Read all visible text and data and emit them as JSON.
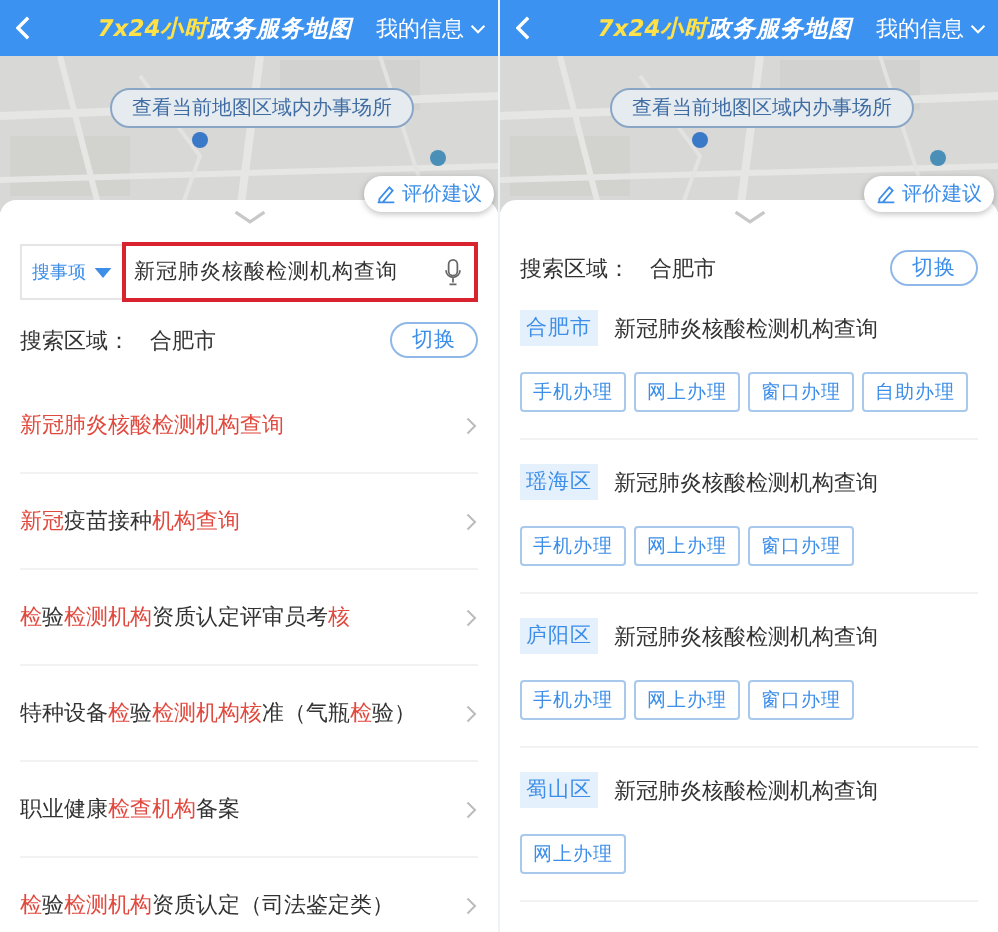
{
  "left": {
    "header": {
      "title": [
        {
          "text": "7x24小时",
          "highlight": true
        },
        {
          "text": "政务服务地图",
          "highlight": false
        }
      ],
      "menu": "我的信息"
    },
    "map": {
      "button": "查看当前地图区域内办事场所",
      "feedback": "评价建议"
    },
    "search": {
      "scope": "搜事项",
      "value": "新冠肺炎核酸检测机构查询",
      "highlighted": true
    },
    "area": {
      "label": "搜索区域：",
      "city": "合肥市",
      "switch": "切换"
    },
    "items": [
      {
        "segments": [
          {
            "text": "新冠肺炎核酸检测机构查询",
            "highlight": true
          }
        ]
      },
      {
        "segments": [
          {
            "text": "新冠",
            "highlight": true
          },
          {
            "text": "疫苗接种",
            "highlight": false
          },
          {
            "text": "机构查询",
            "highlight": true
          }
        ]
      },
      {
        "segments": [
          {
            "text": "检",
            "highlight": true
          },
          {
            "text": "验",
            "highlight": false
          },
          {
            "text": "检测机构",
            "highlight": true
          },
          {
            "text": "资质认定评审员考",
            "highlight": false
          },
          {
            "text": "核",
            "highlight": true
          }
        ]
      },
      {
        "segments": [
          {
            "text": "特种设备",
            "highlight": false
          },
          {
            "text": "检",
            "highlight": true
          },
          {
            "text": "验",
            "highlight": false
          },
          {
            "text": "检测机构核",
            "highlight": true
          },
          {
            "text": "准（气瓶",
            "highlight": false
          },
          {
            "text": "检",
            "highlight": true
          },
          {
            "text": "验）",
            "highlight": false
          }
        ]
      },
      {
        "segments": [
          {
            "text": "职业健康",
            "highlight": false
          },
          {
            "text": "检查机构",
            "highlight": true
          },
          {
            "text": "备案",
            "highlight": false
          }
        ]
      },
      {
        "segments": [
          {
            "text": "检",
            "highlight": true
          },
          {
            "text": "验",
            "highlight": false
          },
          {
            "text": "检测机构",
            "highlight": true
          },
          {
            "text": "资质认定（司法鉴定类）",
            "highlight": false
          }
        ]
      }
    ]
  },
  "right": {
    "header": {
      "title": [
        {
          "text": "7x24小时",
          "highlight": true
        },
        {
          "text": "政务服务地图",
          "highlight": false
        }
      ],
      "menu": "我的信息"
    },
    "map": {
      "button": "查看当前地图区域内办事场所",
      "feedback": "评价建议"
    },
    "area": {
      "label": "搜索区域：",
      "city": "合肥市",
      "switch": "切换"
    },
    "results": [
      {
        "district": "合肥市",
        "title": "新冠肺炎核酸检测机构查询",
        "actions": [
          "手机办理",
          "网上办理",
          "窗口办理",
          "自助办理"
        ]
      },
      {
        "district": "瑶海区",
        "title": "新冠肺炎核酸检测机构查询",
        "actions": [
          "手机办理",
          "网上办理",
          "窗口办理"
        ]
      },
      {
        "district": "庐阳区",
        "title": "新冠肺炎核酸检测机构查询",
        "actions": [
          "手机办理",
          "网上办理",
          "窗口办理"
        ]
      },
      {
        "district": "蜀山区",
        "title": "新冠肺炎核酸检测机构查询",
        "actions": [
          "网上办理"
        ]
      }
    ]
  }
}
